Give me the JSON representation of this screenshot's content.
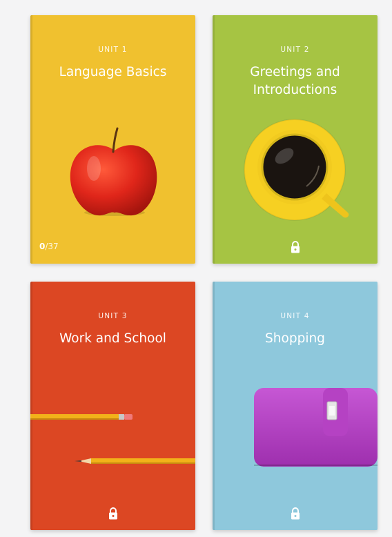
{
  "colors": {
    "unit1": "#f0c12f",
    "unit2": "#a6c443",
    "unit3": "#dc4723",
    "unit4": "#8ec8dc"
  },
  "units": [
    {
      "unit_label": "UNIT 1",
      "title": "Language Basics",
      "progress_done": "0",
      "progress_total": "/37",
      "illustration": "apple-image"
    },
    {
      "unit_label": "UNIT 2",
      "title": "Greetings and Introductions",
      "illustration": "coffee-cup-image",
      "status_icon": "lock-icon"
    },
    {
      "unit_label": "UNIT 3",
      "title": "Work and School",
      "illustration": "pencils-image",
      "status_icon": "lock-icon"
    },
    {
      "unit_label": "UNIT 4",
      "title": "Shopping",
      "illustration": "wallet-image",
      "status_icon": "lock-icon"
    }
  ]
}
